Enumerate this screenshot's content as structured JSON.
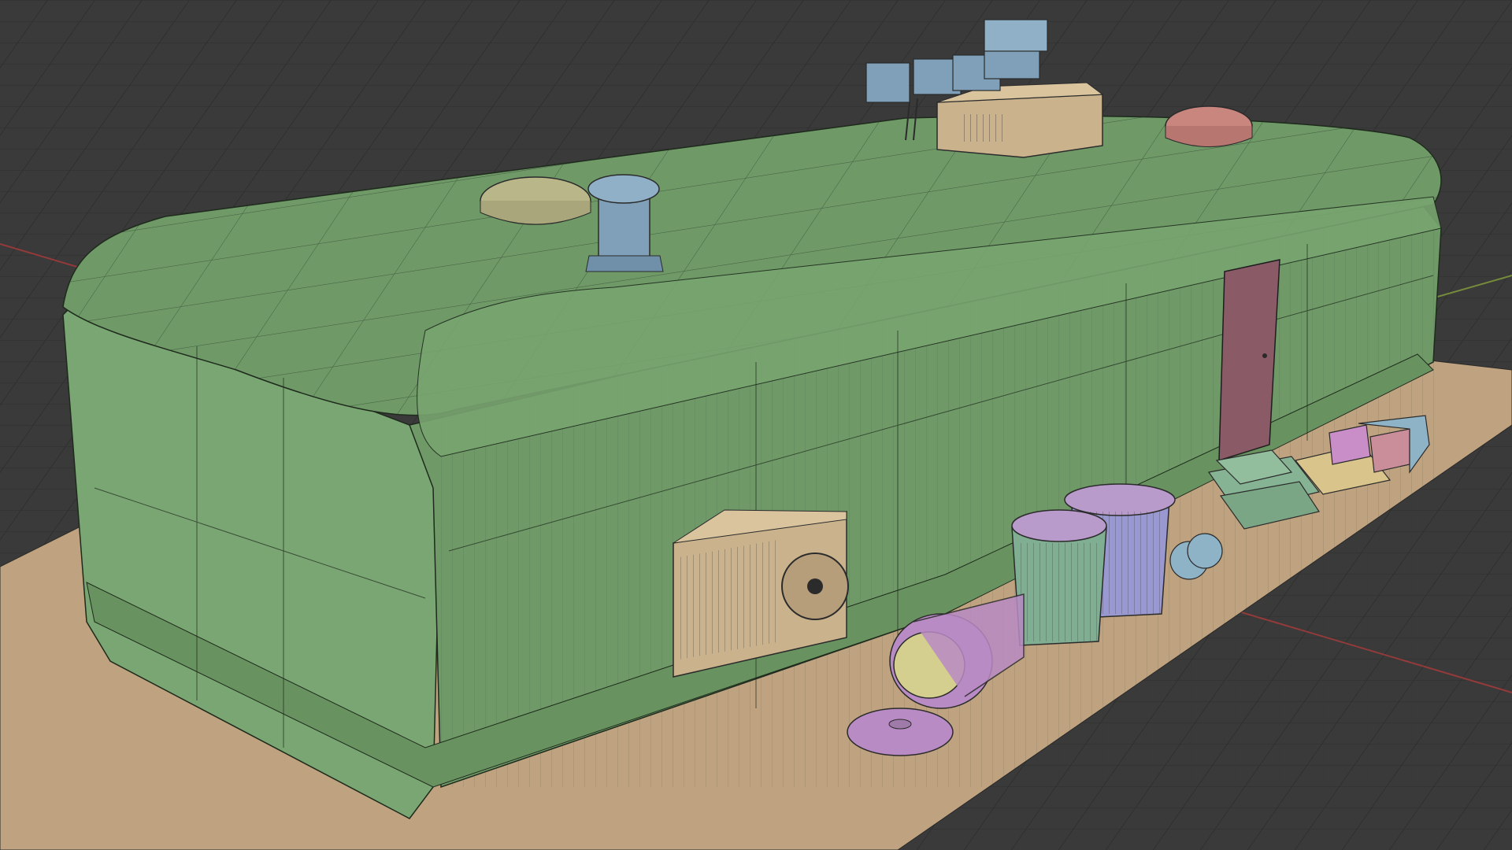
{
  "viewport": {
    "background": "#3a3a3a",
    "grid_color": "#2e2e2e",
    "x_axis_color": "#b33a3a",
    "y_axis_color": "#8aa83a"
  },
  "scene": {
    "building_color": "#7aa673",
    "building_side_color": "#6f9a68",
    "roof_color": "#6f9a68",
    "ground_plane_color": "#bfa27f",
    "wire_color": "#1e2a1c",
    "objects": [
      {
        "name": "green-building",
        "color": "#6f9a68"
      },
      {
        "name": "door",
        "color": "#8a5a66"
      },
      {
        "name": "ac-unit",
        "color": "#c9b28c"
      },
      {
        "name": "roof-hvac-box",
        "color": "#c9b28c"
      },
      {
        "name": "roof-vent-dome-yellow",
        "color": "#b9b78a"
      },
      {
        "name": "roof-vent-dome-red",
        "color": "#c9867f"
      },
      {
        "name": "roof-vent-cylinder",
        "color": "#7fa0b8"
      },
      {
        "name": "roof-fan-units",
        "color": "#7fa0b8"
      },
      {
        "name": "trash-can-green",
        "color": "#7fae92"
      },
      {
        "name": "trash-can-purple",
        "color": "#9a98d0"
      },
      {
        "name": "trash-can-fallen",
        "color": "#b98bc4"
      },
      {
        "name": "trash-lid",
        "color": "#b98bc4"
      },
      {
        "name": "trash-bags",
        "color": "#8fb3c6"
      },
      {
        "name": "steps",
        "color": "#86b394"
      },
      {
        "name": "boxes",
        "color": "#d9c58c"
      }
    ]
  }
}
